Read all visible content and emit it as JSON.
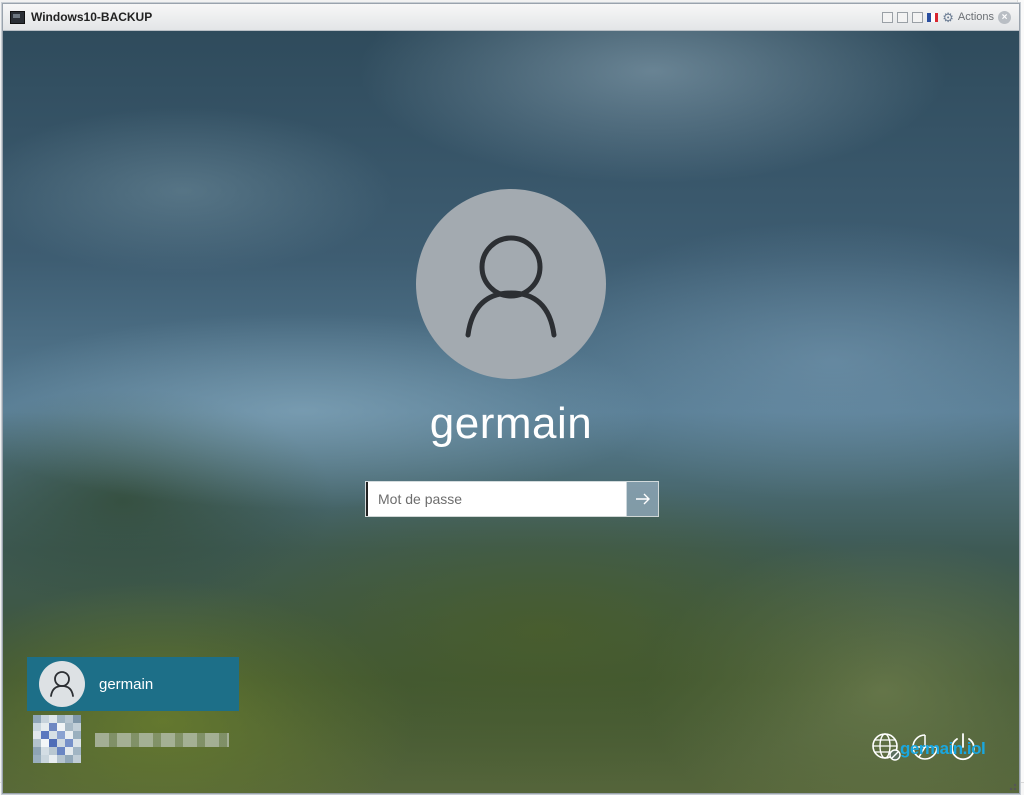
{
  "window": {
    "title": "Windows10-BACKUP",
    "actions_label": "Actions",
    "icons": [
      "console-icon",
      "minimize-box-icon",
      "restore-box-icon",
      "maximize-box-icon",
      "flag-icon",
      "gear-icon",
      "close-icon"
    ]
  },
  "lockscreen": {
    "username": "germain",
    "password_placeholder": "Mot de passe",
    "submit_icon": "arrow-right-icon"
  },
  "user_list": {
    "selected": {
      "name": "germain",
      "icon": "person-icon"
    },
    "other": {
      "icon": "pixelated-avatar"
    }
  },
  "system_icons": [
    "network-icon",
    "accessibility-icon",
    "power-icon"
  ],
  "watermark": "germain.iol",
  "colors": {
    "selected_tile": "#1d6f88",
    "avatar_circle": "#a3aab0",
    "watermark": "#19a7e0"
  }
}
